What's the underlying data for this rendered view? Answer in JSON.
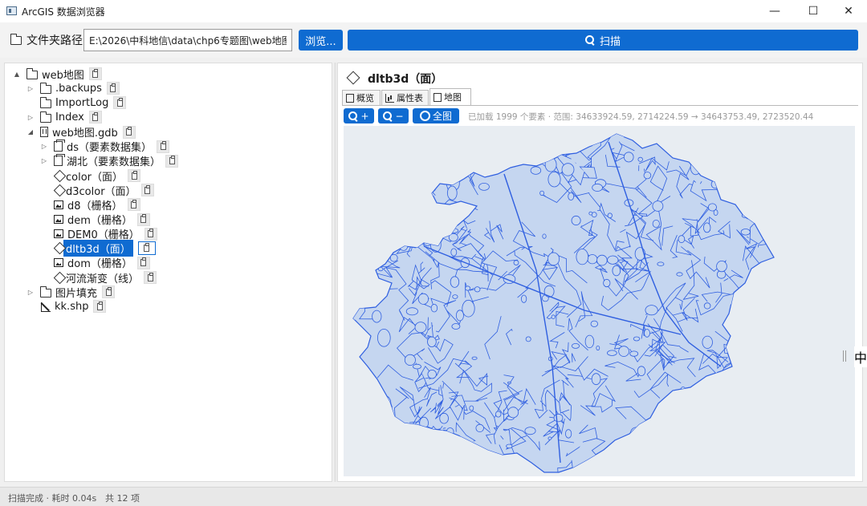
{
  "window": {
    "title": "ArcGIS 数据浏览器",
    "minimize": "—",
    "maximize": "☐",
    "close": "✕"
  },
  "toolbar": {
    "path_label": "文件夹路径",
    "path_value": "E:\\2026\\中科地信\\data\\chp6专题图\\web地图",
    "browse_label": "浏览...",
    "scan_label": "扫描"
  },
  "tree": [
    {
      "label": "web地图",
      "icon": "folder-icon",
      "arrow": "▲",
      "indent": 0
    },
    {
      "label": ".backups",
      "icon": "folder-icon",
      "arrow": "▷",
      "indent": 1
    },
    {
      "label": "ImportLog",
      "icon": "folder-icon",
      "arrow": "",
      "indent": 1
    },
    {
      "label": "Index",
      "icon": "folder-icon",
      "arrow": "▷",
      "indent": 1
    },
    {
      "label": "web地图.gdb",
      "icon": "geodatabase-icon",
      "arrow": "◢",
      "indent": 1
    },
    {
      "label": "ds（要素数据集）",
      "icon": "feature-dataset-icon",
      "arrow": "▷",
      "indent": 2
    },
    {
      "label": "湖北（要素数据集）",
      "icon": "feature-dataset-icon",
      "arrow": "▷",
      "indent": 2
    },
    {
      "label": "color（面）",
      "icon": "polygon-icon",
      "arrow": "",
      "indent": 2
    },
    {
      "label": "d3color（面）",
      "icon": "polygon-icon",
      "arrow": "",
      "indent": 2
    },
    {
      "label": "d8（栅格）",
      "icon": "raster-icon",
      "arrow": "",
      "indent": 2
    },
    {
      "label": "dem（栅格）",
      "icon": "raster-icon",
      "arrow": "",
      "indent": 2
    },
    {
      "label": "DEM0（栅格）",
      "icon": "raster-icon",
      "arrow": "",
      "indent": 2
    },
    {
      "label": "dltb3d（面）",
      "icon": "polygon-icon",
      "arrow": "",
      "indent": 2,
      "selected": true
    },
    {
      "label": "dom（栅格）",
      "icon": "raster-icon",
      "arrow": "",
      "indent": 2
    },
    {
      "label": "河流渐变（线）",
      "icon": "polygon-icon",
      "arrow": "",
      "indent": 2
    },
    {
      "label": "图片填充",
      "icon": "folder-icon",
      "arrow": "▷",
      "indent": 1
    },
    {
      "label": "kk.shp",
      "icon": "shapefile-icon",
      "arrow": "",
      "indent": 1
    }
  ],
  "detail": {
    "title": "dltb3d（面）",
    "tabs": [
      "概览",
      "属性表",
      "地图"
    ],
    "active_tab": "地图",
    "zoom_in_label": "+",
    "zoom_out_label": "−",
    "full_extent_label": "全图",
    "info": "已加载 1999 个要素 · 范围: 34633924.59, 2714224.59 → 34643753.49, 2723520.44"
  },
  "map": {
    "fill": "#c5d6f0",
    "stroke": "#2f5fe0",
    "background": "#e8edf2"
  },
  "ime": {
    "label": "中"
  },
  "status": {
    "left": "扫描完成 · 耗时 0.04s",
    "count": "共 12 项"
  },
  "colors": {
    "accent": "#0f6bd1"
  }
}
